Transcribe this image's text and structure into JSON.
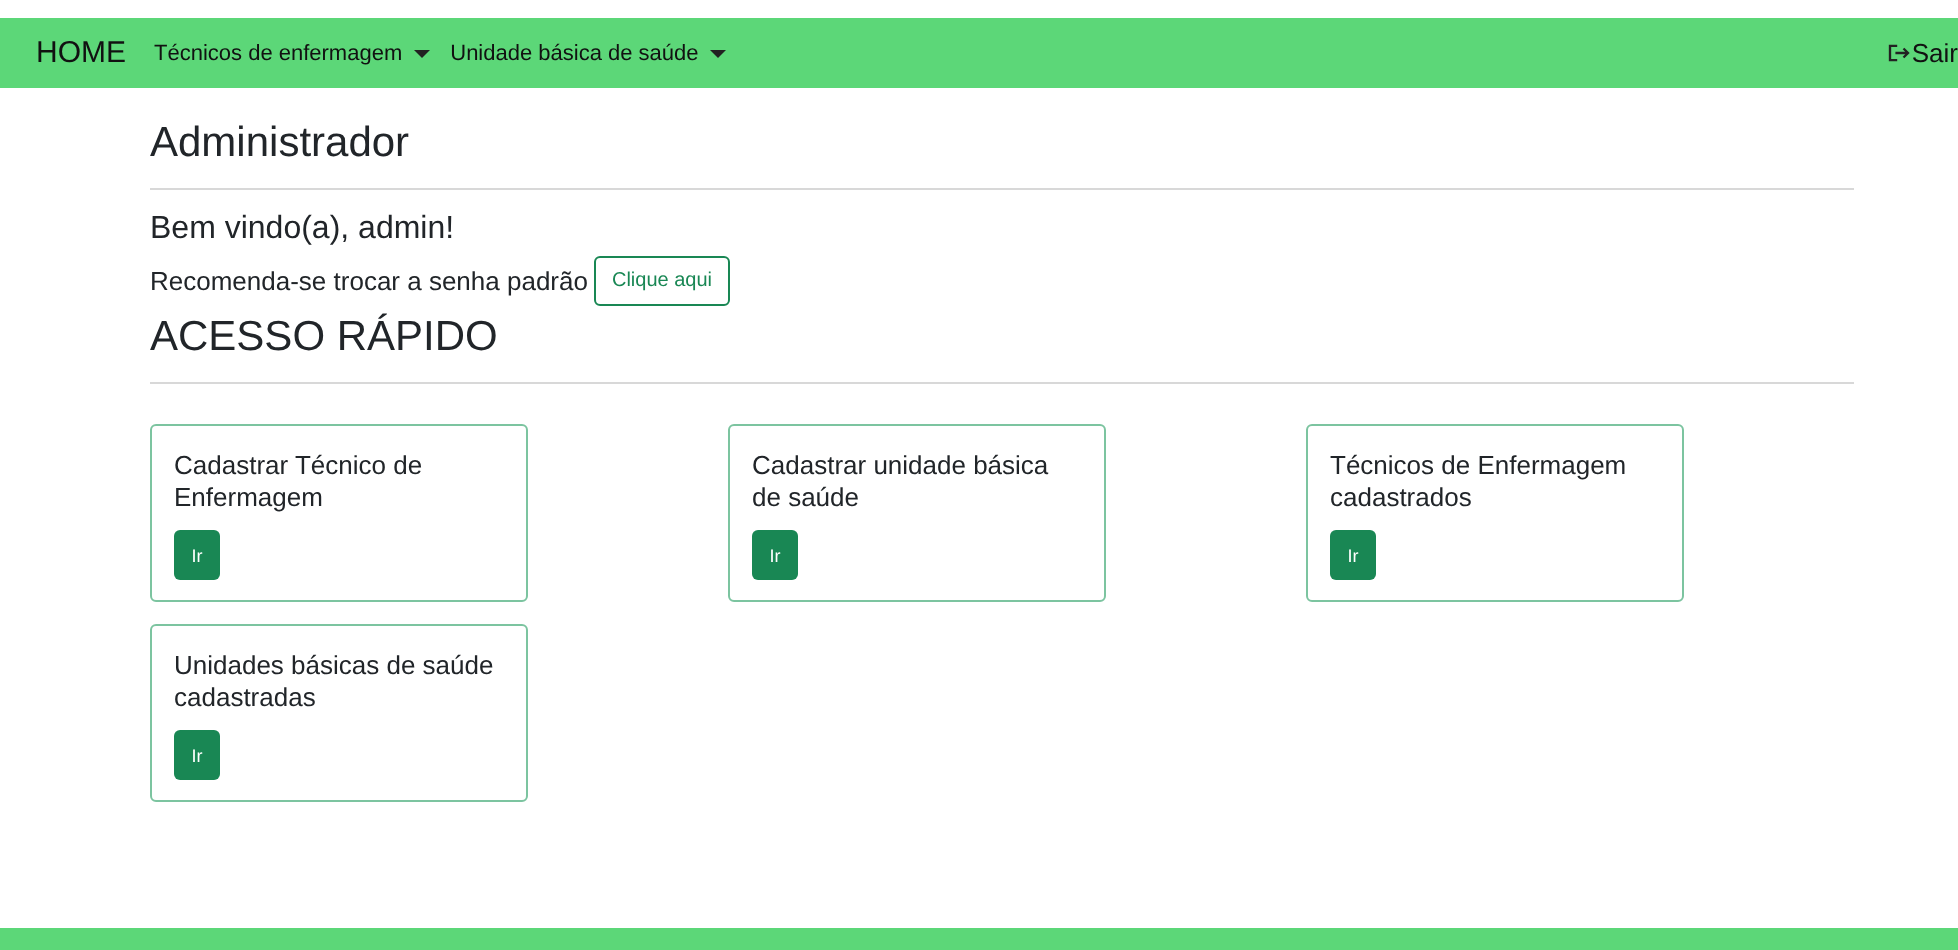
{
  "navbar": {
    "brand": "HOME",
    "menus": [
      {
        "label": "Técnicos de enfermagem",
        "dropdown": true
      },
      {
        "label": "Unidade básica de saúde",
        "dropdown": true
      }
    ],
    "logout": "Sair"
  },
  "page_title": "Administrador",
  "welcome": "Bem vindo(a), admin!",
  "password_notice": {
    "text": "Recomenda-se trocar a senha padrão",
    "button": "Clique aqui"
  },
  "section_title": "ACESSO RÁPIDO",
  "cards": [
    {
      "title": "Cadastrar Técnico de Enfermagem",
      "button": "Ir"
    },
    {
      "title": "Cadastrar unidade básica de saúde",
      "button": "Ir"
    },
    {
      "title": "Técnicos de Enfermagem cadastrados",
      "button": "Ir"
    },
    {
      "title": "Unidades básicas de saúde cadastradas",
      "button": "Ir"
    }
  ]
}
